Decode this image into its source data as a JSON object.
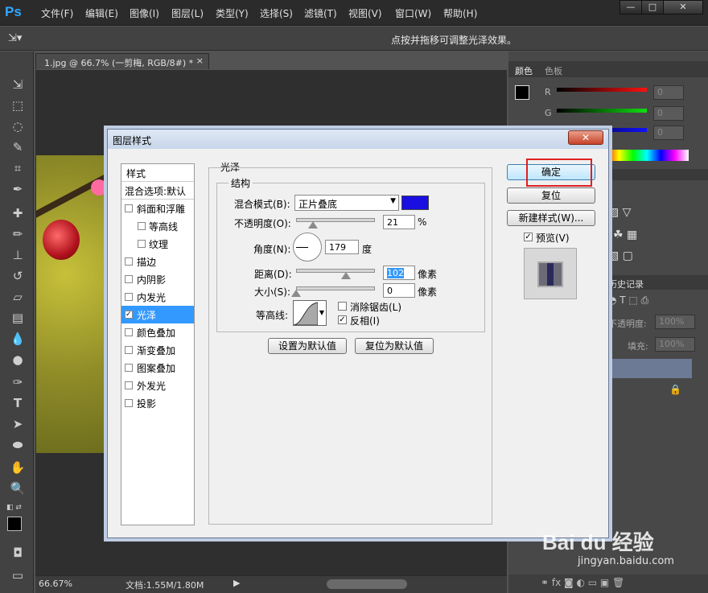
{
  "app": {
    "logo": "Ps"
  },
  "menu": [
    "文件(F)",
    "编辑(E)",
    "图像(I)",
    "图层(L)",
    "类型(Y)",
    "选择(S)",
    "滤镜(T)",
    "视图(V)",
    "窗口(W)",
    "帮助(H)"
  ],
  "window_buttons": {
    "minimize": "—",
    "maximize": "□",
    "close": "✕"
  },
  "options_bar": {
    "tip": "点按并拖移可调整光泽效果。"
  },
  "document": {
    "tab_title": "1.jpg @ 66.7% (一剪梅, RGB/8#) *",
    "zoom": "66.67%",
    "doc_size": "文档:1.55M/1.80M"
  },
  "color_panel": {
    "tabs": [
      "颜色",
      "色板"
    ],
    "channels": [
      {
        "label": "R",
        "value": "0",
        "color": "#e01818"
      },
      {
        "label": "G",
        "value": "0",
        "color": "#18c818"
      },
      {
        "label": "B",
        "value": "0",
        "color": "#1818e0"
      }
    ]
  },
  "history_panel": {
    "tab": "历史记录"
  },
  "layers_panel": {
    "opacity_label": "不透明度:",
    "opacity_value": "100%",
    "fill_label": "填充:",
    "fill_value": "100%"
  },
  "dialog": {
    "title": "图层样式",
    "close": "✕",
    "styles_header": "样式",
    "blend_default": "混合选项:默认",
    "styles": [
      {
        "label": "斜面和浮雕",
        "checked": false,
        "indent": false
      },
      {
        "label": "等高线",
        "checked": false,
        "indent": true
      },
      {
        "label": "纹理",
        "checked": false,
        "indent": true
      },
      {
        "label": "描边",
        "checked": false,
        "indent": false
      },
      {
        "label": "内阴影",
        "checked": false,
        "indent": false
      },
      {
        "label": "内发光",
        "checked": false,
        "indent": false
      },
      {
        "label": "光泽",
        "checked": true,
        "indent": false,
        "selected": true
      },
      {
        "label": "颜色叠加",
        "checked": false,
        "indent": false
      },
      {
        "label": "渐变叠加",
        "checked": false,
        "indent": false
      },
      {
        "label": "图案叠加",
        "checked": false,
        "indent": false
      },
      {
        "label": "外发光",
        "checked": false,
        "indent": false
      },
      {
        "label": "投影",
        "checked": false,
        "indent": false
      }
    ],
    "section_title": "光泽",
    "group_title": "结构",
    "blend_mode_label": "混合模式(B):",
    "blend_mode_value": "正片叠底",
    "blend_color": "#1a0ee0",
    "opacity_label": "不透明度(O):",
    "opacity_value": "21",
    "opacity_unit": "%",
    "angle_label": "角度(N):",
    "angle_value": "179",
    "angle_unit": "度",
    "distance_label": "距离(D):",
    "distance_value": "102",
    "distance_unit": "像素",
    "size_label": "大小(S):",
    "size_value": "0",
    "size_unit": "像素",
    "contour_label": "等高线:",
    "antialias_label": "消除锯齿(L)",
    "antialias_checked": false,
    "invert_label": "反相(I)",
    "invert_checked": true,
    "set_default": "设置为默认值",
    "reset_default": "复位为默认值",
    "ok": "确定",
    "reset": "复位",
    "new_style": "新建样式(W)...",
    "preview_label": "预览(V)",
    "preview_checked": true
  },
  "watermark": {
    "text": "Bai du 经验",
    "sub": "jingyan.baidu.com"
  }
}
